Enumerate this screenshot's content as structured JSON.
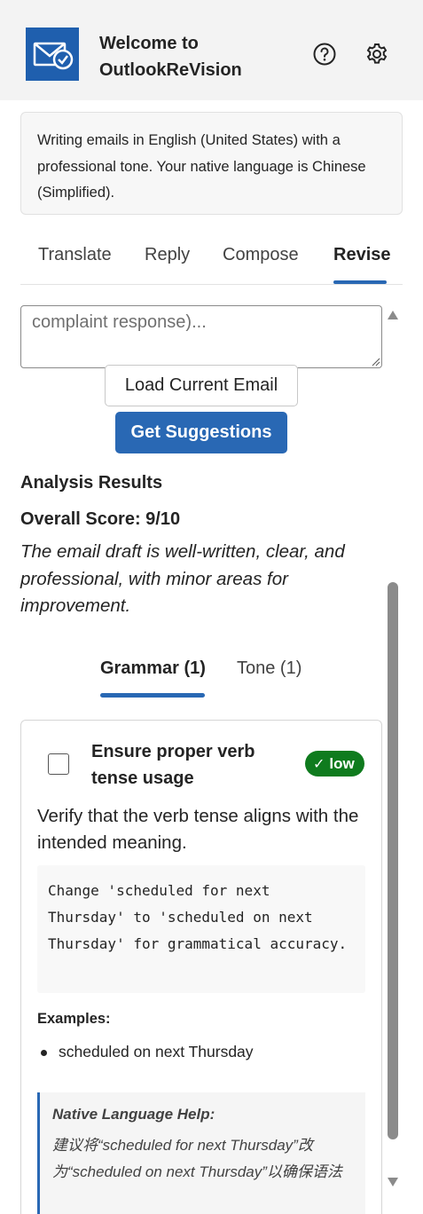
{
  "header": {
    "title": "Welcome to OutlookReVision",
    "logo_icon": "mail-check-icon",
    "help_icon": "help-icon",
    "settings_icon": "gear-icon"
  },
  "info": {
    "text": "Writing emails in English (United States) with a professional tone. Your native language is Chinese (Simplified)."
  },
  "tabs": [
    {
      "label": "Translate"
    },
    {
      "label": "Reply"
    },
    {
      "label": "Compose"
    },
    {
      "label": "Revise",
      "active": true
    }
  ],
  "revise": {
    "textarea_text": "complaint response)...",
    "load_button": "Load Current Email",
    "suggest_button": "Get Suggestions"
  },
  "analysis": {
    "title": "Analysis Results",
    "overall_score": "Overall Score: 9/10",
    "summary": "The email draft is well-written, clear, and professional, with minor areas for improvement."
  },
  "subtabs": [
    {
      "label": "Grammar (1)",
      "active": true
    },
    {
      "label": "Tone (1)"
    }
  ],
  "suggestion": {
    "title": "Ensure proper verb tense usage",
    "severity": "low",
    "description": "Verify that the verb tense aligns with the intended meaning.",
    "code": "Change 'scheduled for next Thursday' to 'scheduled on next Thursday' for grammatical accuracy.",
    "examples_label": "Examples:",
    "examples": [
      "scheduled on next Thursday"
    ],
    "native_help_title": "Native Language Help:",
    "native_help_text": "建议将“scheduled for next Thursday”改为“scheduled on next Thursday”以确保语法"
  },
  "colors": {
    "accent": "#2968b4",
    "logo_bg": "#1f5fae",
    "badge_low": "#0f7b1e",
    "header_bg": "#f3f3f3"
  }
}
